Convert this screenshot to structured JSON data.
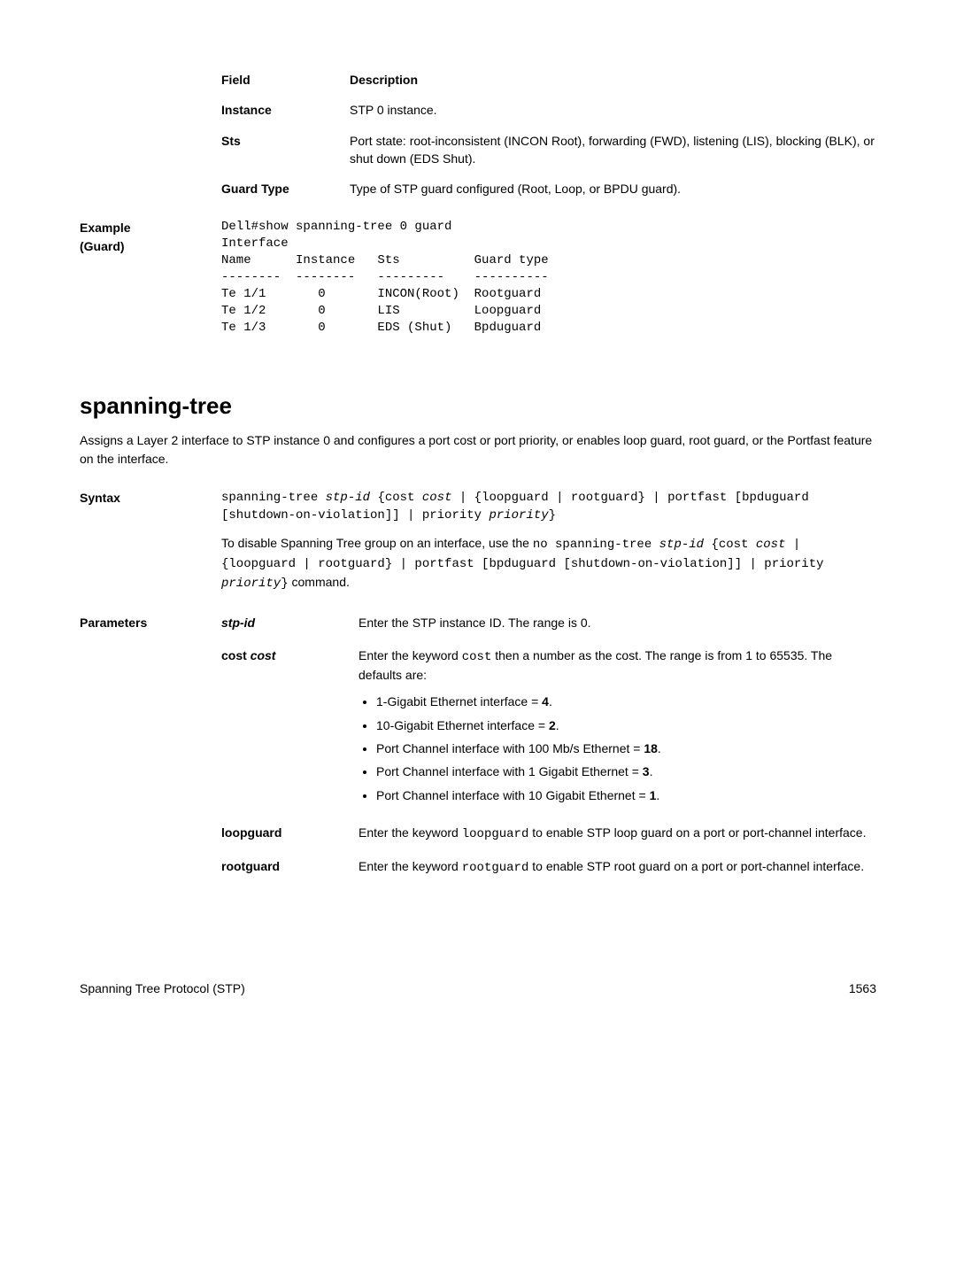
{
  "fields_table": {
    "header_field": "Field",
    "header_desc": "Description",
    "rows": [
      {
        "label": "Instance",
        "desc": "STP 0 instance."
      },
      {
        "label": "Sts",
        "desc": "Port state: root-inconsistent (INCON Root), forwarding (FWD), listening (LIS), blocking (BLK), or shut down (EDS Shut)."
      },
      {
        "label": "Guard Type",
        "desc": "Type of STP guard configured (Root, Loop, or BPDU guard)."
      }
    ]
  },
  "example": {
    "label1": "Example",
    "label2": "(Guard)",
    "code": "Dell#show spanning-tree 0 guard\nInterface\nName      Instance   Sts          Guard type\n--------  --------   ---------    ----------\nTe 1/1       0       INCON(Root)  Rootguard\nTe 1/2       0       LIS          Loopguard\nTe 1/3       0       EDS (Shut)   Bpduguard"
  },
  "section": {
    "title": "spanning-tree",
    "intro": "Assigns a Layer 2 interface to STP instance 0 and configures a port cost or port priority, or enables loop guard, root guard, or the Portfast feature on the interface."
  },
  "syntax": {
    "label": "Syntax",
    "code_parts": {
      "p1": "spanning-tree ",
      "p2": "stp-id",
      "p3": " {cost ",
      "p4": "cost",
      "p5": " | {loopguard | rootguard} | portfast [bpduguard [shutdown-on-violation]] | priority ",
      "p6": "priority",
      "p7": "}"
    },
    "disable_pre": "To disable Spanning Tree group on an interface, use the ",
    "disable_code_parts": {
      "p1": "no spanning-tree ",
      "p2": "stp-id",
      "p3": " {cost ",
      "p4": "cost",
      "p5": " | {loopguard | rootguard} | portfast [bpduguard [shutdown-on-violation]] | priority ",
      "p6": "priority",
      "p7": "}"
    },
    "disable_post": " command."
  },
  "parameters": {
    "label": "Parameters",
    "rows": [
      {
        "name": "stp-id",
        "name_style": "bold-italic",
        "desc": "Enter the STP instance ID. The range is 0."
      },
      {
        "name_pre": "cost ",
        "name_em": "cost",
        "desc_pre": "Enter the keyword ",
        "desc_code": "cost",
        "desc_post": " then a number as the cost. The range is from 1 to 65535. The defaults are:",
        "bullets": [
          {
            "t": "1-Gigabit Ethernet interface = ",
            "b": "4",
            "tail": "."
          },
          {
            "t": "10-Gigabit Ethernet interface = ",
            "b": "2",
            "tail": "."
          },
          {
            "t": "Port Channel interface with 100 Mb/s Ethernet = ",
            "b": "18",
            "tail": "."
          },
          {
            "t": "Port Channel interface with 1 Gigabit Ethernet = ",
            "b": "3",
            "tail": "."
          },
          {
            "t": "Port Channel interface with 10 Gigabit Ethernet = ",
            "b": "1",
            "tail": "."
          }
        ]
      },
      {
        "name": "loopguard",
        "desc_pre": "Enter the keyword ",
        "desc_code": "loopguard",
        "desc_post": " to enable STP loop guard on a port or port-channel interface."
      },
      {
        "name": "rootguard",
        "desc_pre": "Enter the keyword ",
        "desc_code": "rootguard",
        "desc_post": " to enable STP root guard on a port or port-channel interface."
      }
    ]
  },
  "footer": {
    "left": "Spanning Tree Protocol (STP)",
    "right": "1563"
  }
}
